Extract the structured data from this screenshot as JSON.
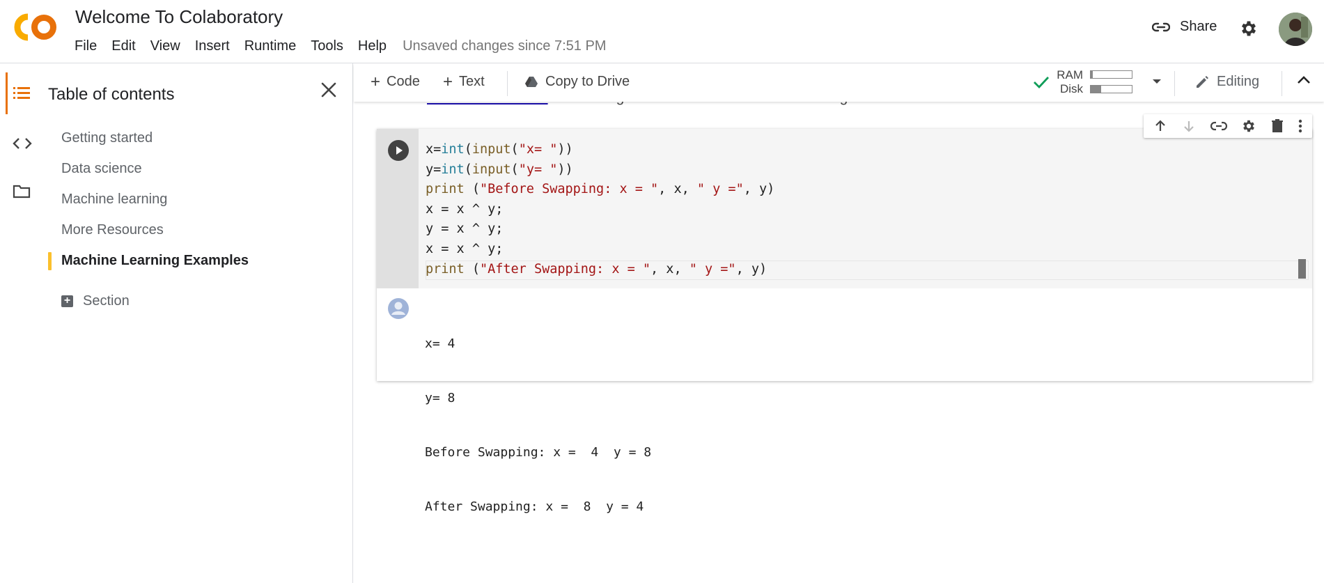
{
  "header": {
    "logo_text": "CO",
    "title": "Welcome To Colaboratory",
    "menu": [
      "File",
      "Edit",
      "View",
      "Insert",
      "Runtime",
      "Tools",
      "Help"
    ],
    "status": "Unsaved changes since 7:51 PM",
    "share_label": "Share"
  },
  "toc": {
    "title": "Table of contents",
    "items": [
      "Getting started",
      "Data science",
      "Machine learning",
      "More Resources",
      "Machine Learning Examples"
    ],
    "active_index": 4,
    "section_label": "Section"
  },
  "toolbar": {
    "add_code": "Code",
    "add_text": "Text",
    "copy_to_drive": "Copy to Drive",
    "ram_label": "RAM",
    "disk_label": "Disk",
    "ram_usage": 0.05,
    "disk_usage": 0.25,
    "mode_label": "Editing"
  },
  "partial_text": {
    "link": "Convolutional VAE",
    "rest": ": Create a generative model of handwritten digits."
  },
  "cell": {
    "code_lines": [
      "x=int(input(\"x= \"))",
      "y=int(input(\"y= \"))",
      "print (\"Before Swapping: x = \", x, \" y =\", y)",
      "x = x ^ y;",
      "y = x ^ y;",
      "x = x ^ y;",
      "print (\"After Swapping: x = \", x, \" y =\", y)"
    ],
    "output_lines": [
      "x= 4",
      "y= 8",
      "Before Swapping: x =  4  y = 8",
      "After Swapping: x =  8  y = 4"
    ]
  },
  "colors": {
    "accent_orange": "#e8710a",
    "logo_yellow": "#f9ab00",
    "toc_active_marker": "#fbc02d",
    "check_green": "#0f9d58",
    "keyword": "#795e26",
    "builtin": "#267f99",
    "string": "#a31515"
  }
}
